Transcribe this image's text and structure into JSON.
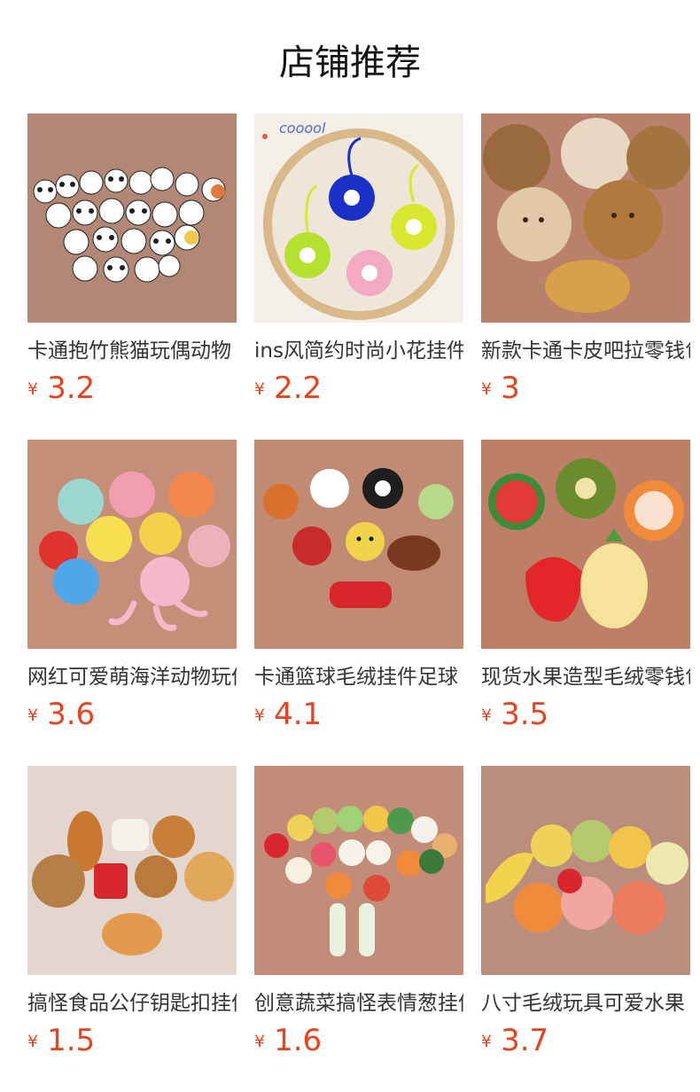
{
  "page": {
    "title": "店铺推荐"
  },
  "products": [
    {
      "name": "卡通抱竹熊猫玩偶动物",
      "currency": "¥",
      "price": "3.2",
      "bg": "#b28775",
      "image_icon": "panda-plush-icon"
    },
    {
      "name": "ins风简约时尚小花挂件",
      "currency": "¥",
      "price": "2.2",
      "bg": "#f4efe6",
      "image_icon": "flower-keychain-icon",
      "overlay_text": "cooool"
    },
    {
      "name": "新款卡通卡皮吧拉零钱包",
      "currency": "¥",
      "price": "3",
      "bg": "#b9806b",
      "image_icon": "cookie-plush-icon"
    },
    {
      "name": "网红可爱萌海洋动物玩偶",
      "currency": "¥",
      "price": "3.6",
      "bg": "#c58e78",
      "image_icon": "sea-animal-plush-icon"
    },
    {
      "name": "卡通篮球毛绒挂件足球",
      "currency": "¥",
      "price": "4.1",
      "bg": "#c18a73",
      "image_icon": "ball-plush-icon"
    },
    {
      "name": "现货水果造型毛绒零钱包",
      "currency": "¥",
      "price": "3.5",
      "bg": "#bd7f66",
      "image_icon": "fruit-purse-icon"
    },
    {
      "name": "搞怪食品公仔钥匙扣挂件",
      "currency": "¥",
      "price": "1.5",
      "bg": "#e3d6cf",
      "image_icon": "food-plush-icon"
    },
    {
      "name": "创意蔬菜搞怪表情葱挂件",
      "currency": "¥",
      "price": "1.6",
      "bg": "#c28c78",
      "image_icon": "vegetable-plush-icon"
    },
    {
      "name": "八寸毛绒玩具可爱水果",
      "currency": "¥",
      "price": "3.7",
      "bg": "#b98e7c",
      "image_icon": "fruit-plush-icon"
    }
  ]
}
